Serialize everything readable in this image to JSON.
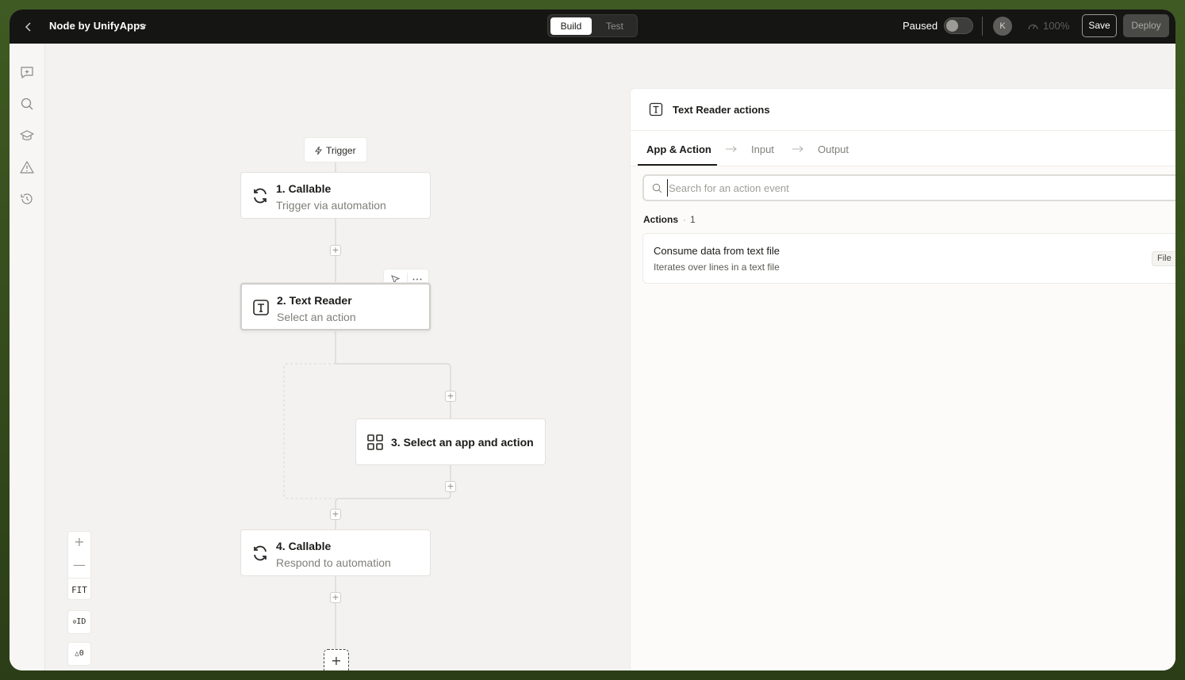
{
  "header": {
    "back_icon": "chevron-left-icon",
    "title": "Node by UnifyApps",
    "mode_tabs": [
      {
        "label": "Build",
        "active": true
      },
      {
        "label": "Test",
        "active": false
      }
    ],
    "paused_label": "Paused",
    "paused_toggle_on": false,
    "avatar_initial": "K",
    "zoom_level": "100%",
    "save_label": "Save",
    "deploy_label": "Deploy"
  },
  "sidebar": {
    "icons": [
      "sparkle-chat-icon",
      "search-icon",
      "graduation-cap-icon",
      "warning-icon",
      "history-icon"
    ]
  },
  "canvas": {
    "trigger_label": "Trigger",
    "nodes": [
      {
        "title": "1. Callable",
        "subtitle": "Trigger via automation",
        "icon": "sync-icon"
      },
      {
        "title": "2. Text Reader",
        "subtitle": "Select an action",
        "icon": "text-icon",
        "selected": true
      },
      {
        "title": "3. Select an app and action",
        "subtitle": "",
        "icon": "grid-icon"
      },
      {
        "title": "4. Callable",
        "subtitle": "Respond to automation",
        "icon": "sync-icon"
      }
    ],
    "zoom_controls": {
      "plus": "+",
      "minus": "—",
      "fit": "FIT"
    },
    "id_toggle": "ID",
    "warning_count": "0"
  },
  "panel": {
    "title": "Text Reader actions",
    "tabs": [
      {
        "label": "App & Action",
        "active": true
      },
      {
        "label": "Input",
        "active": false
      },
      {
        "label": "Output",
        "active": false
      }
    ],
    "search_placeholder": "Search for an action event",
    "section_label": "Actions",
    "section_count": "1",
    "actions": [
      {
        "title": "Consume data from text file",
        "description": "Iterates over lines in a text file",
        "tag": "File"
      }
    ]
  }
}
